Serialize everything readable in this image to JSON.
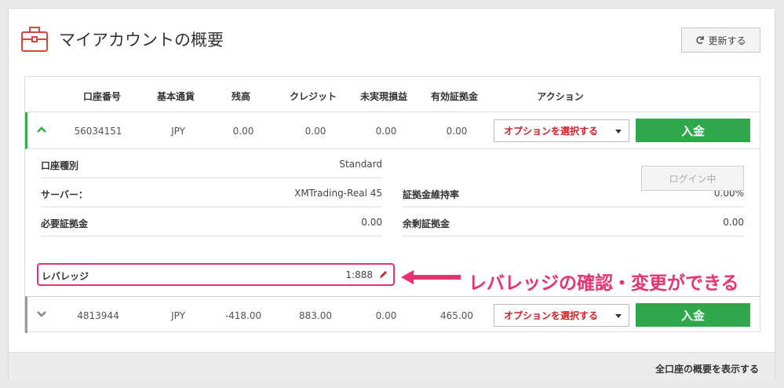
{
  "header": {
    "title": "マイアカウントの概要",
    "refresh_label": "更新する"
  },
  "table": {
    "columns": [
      "口座番号",
      "基本通貨",
      "残高",
      "クレジット",
      "未実現損益",
      "有効証拠金",
      "アクション"
    ],
    "rows": [
      {
        "account": "56034151",
        "currency": "JPY",
        "balance": "0.00",
        "credit": "0.00",
        "unrealized": "0.00",
        "equity": "0.00",
        "select_label": "オプションを選択する",
        "deposit_label": "入金",
        "expanded": true
      },
      {
        "account": "4813944",
        "currency": "JPY",
        "balance": "-418.00",
        "credit": "883.00",
        "unrealized": "0.00",
        "equity": "465.00",
        "select_label": "オプションを選択する",
        "deposit_label": "入金",
        "expanded": false
      }
    ]
  },
  "details": {
    "account_type_label": "口座種別",
    "account_type_value": "Standard",
    "server_label": "サーバー：",
    "server_value": "XMTrading-Real 45",
    "required_margin_label": "必要証拠金",
    "required_margin_value": "0.00",
    "leverage_label": "レバレッジ",
    "leverage_value": "1:888",
    "margin_level_label": "証拠金維持率",
    "margin_level_value": "0.00%",
    "free_margin_label": "余剰証拠金",
    "free_margin_value": "0.00",
    "login_label": "ログイン中"
  },
  "annotation": {
    "text": "レバレッジの確認・変更ができる",
    "color": "#e8336e"
  },
  "footer": {
    "link_label": "全口座の概要を表示する"
  },
  "colors": {
    "accent_green": "#2ea84a",
    "select_red": "#c9252a",
    "highlight_pink": "#e8336e"
  }
}
